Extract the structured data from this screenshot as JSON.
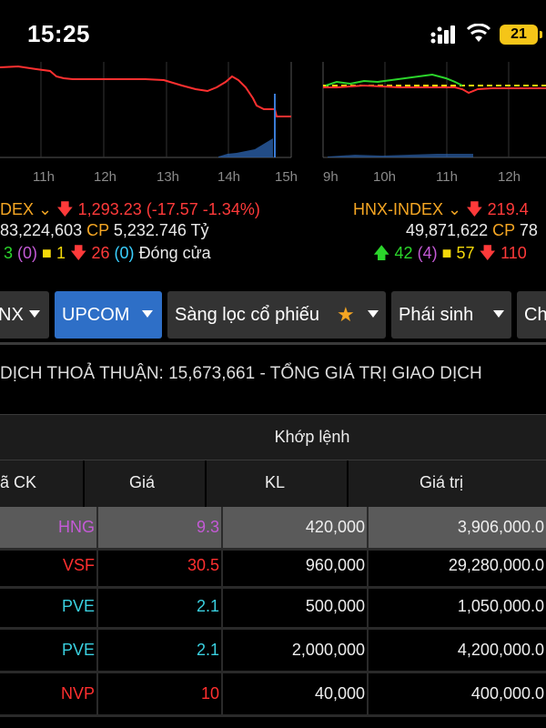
{
  "status_bar": {
    "time": "15:25",
    "battery": "21"
  },
  "charts": {
    "left_axis_labels": [
      "11h",
      "12h",
      "13h",
      "14h",
      "15h"
    ],
    "right_axis_labels": [
      "9h",
      "10h",
      "11h",
      "12h"
    ]
  },
  "vnindex": {
    "name": "DEX",
    "value": "1,293.23",
    "change": "(-17.57 -1.34%)",
    "volume": "83,224,603",
    "cp_label": "CP",
    "turnover": "5,232.746 Tỷ",
    "up": "3",
    "up_ceiling": "(0)",
    "unchanged": "1",
    "down": "26",
    "down_floor": "(0)",
    "session": "Đóng cửa"
  },
  "hnxindex": {
    "name": "HNX-INDEX",
    "value": "219.4",
    "volume": "49,871,622",
    "cp_label": "CP",
    "turnover": "78",
    "up": "42",
    "up_ceiling": "(4)",
    "unchanged": "57",
    "down": "110"
  },
  "tabs": [
    {
      "label": "NX",
      "active": false
    },
    {
      "label": "UPCOM",
      "active": true
    },
    {
      "label": "Sàng lọc cổ phiếu",
      "active": false
    },
    {
      "label": "Phái sinh",
      "active": false
    },
    {
      "label": "Ch",
      "active": false
    }
  ],
  "ticker_text": "DỊCH THOẢ THUẬN: 15,673,661  -  TỔNG GIÁ TRỊ GIAO DỊCH",
  "table": {
    "group_header": "Khớp lệnh",
    "columns": [
      "ã CK",
      "Giá",
      "KL",
      "Giá trị"
    ],
    "rows": [
      {
        "code": "HNG",
        "price": "9.3",
        "volume": "420,000",
        "value": "3,906,000.0",
        "color": "#c45ad6",
        "highlight": true
      },
      {
        "code": "VSF",
        "price": "30.5",
        "volume": "960,000",
        "value": "29,280,000.0",
        "color": "#ff2f2f",
        "highlight": false
      },
      {
        "code": "PVE",
        "price": "2.1",
        "volume": "500,000",
        "value": "1,050,000.0",
        "color": "#3ad0e0",
        "highlight": false
      },
      {
        "code": "PVE",
        "price": "2.1",
        "volume": "2,000,000",
        "value": "4,200,000.0",
        "color": "#3ad0e0",
        "highlight": false
      },
      {
        "code": "NVP",
        "price": "10",
        "volume": "40,000",
        "value": "400,000.0",
        "color": "#ff2f2f",
        "highlight": false
      }
    ]
  }
}
